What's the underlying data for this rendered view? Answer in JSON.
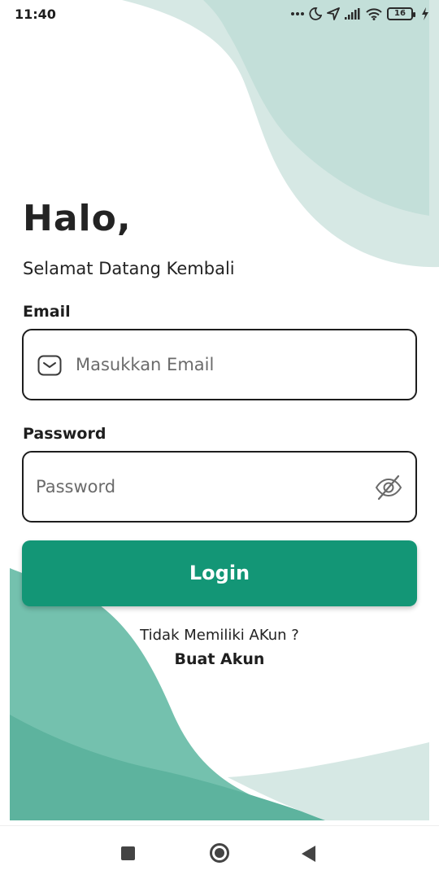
{
  "status_bar": {
    "time": "11:40",
    "battery_level": "16",
    "icons": [
      "more-dots-icon",
      "moon-icon",
      "location-arrow-icon",
      "signal-icon",
      "wifi-icon",
      "battery-icon",
      "charging-bolt-icon"
    ]
  },
  "login": {
    "greeting": "Halo,",
    "subtitle": "Selamat Datang Kembali",
    "email_label": "Email",
    "email_placeholder": "Masukkan Email",
    "email_value": "",
    "password_label": "Password",
    "password_placeholder": "Password",
    "password_value": "",
    "login_button": "Login",
    "signup_prompt": "Tidak Memiliki AKun ?",
    "signup_link": "Buat Akun"
  },
  "nav_bar": {
    "icons": [
      "recents-square-icon",
      "home-circle-icon",
      "back-triangle-icon"
    ]
  },
  "colors": {
    "primary": "#139676",
    "wave_light": "#d6e8e4",
    "wave_mid": "#c3dfd9",
    "wave_bottom_light": "#74c1ae",
    "wave_bottom_dark": "#5db39e"
  }
}
